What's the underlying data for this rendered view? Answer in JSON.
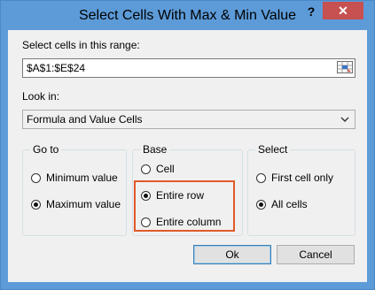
{
  "window": {
    "title": "Select Cells With Max & Min Value",
    "help_glyph": "?",
    "close_glyph": "✕"
  },
  "range": {
    "label": "Select cells in this range:",
    "value": "$A$1:$E$24"
  },
  "look_in": {
    "label": "Look in:",
    "selected": "Formula and Value Cells"
  },
  "goto": {
    "title": "Go to",
    "options": [
      {
        "label": "Minimum value",
        "checked": false
      },
      {
        "label": "Maximum value",
        "checked": true
      }
    ]
  },
  "base": {
    "title": "Base",
    "options": [
      {
        "label": "Cell",
        "checked": false
      },
      {
        "label": "Entire row",
        "checked": true
      },
      {
        "label": "Entire column",
        "checked": false
      }
    ]
  },
  "select": {
    "title": "Select",
    "options": [
      {
        "label": "First cell only",
        "checked": false
      },
      {
        "label": "All cells",
        "checked": true
      }
    ]
  },
  "buttons": {
    "ok": "Ok",
    "cancel": "Cancel"
  },
  "colors": {
    "title_bar": "#5d9bd8",
    "close_button": "#c75050",
    "highlight": "#e05a2b"
  }
}
